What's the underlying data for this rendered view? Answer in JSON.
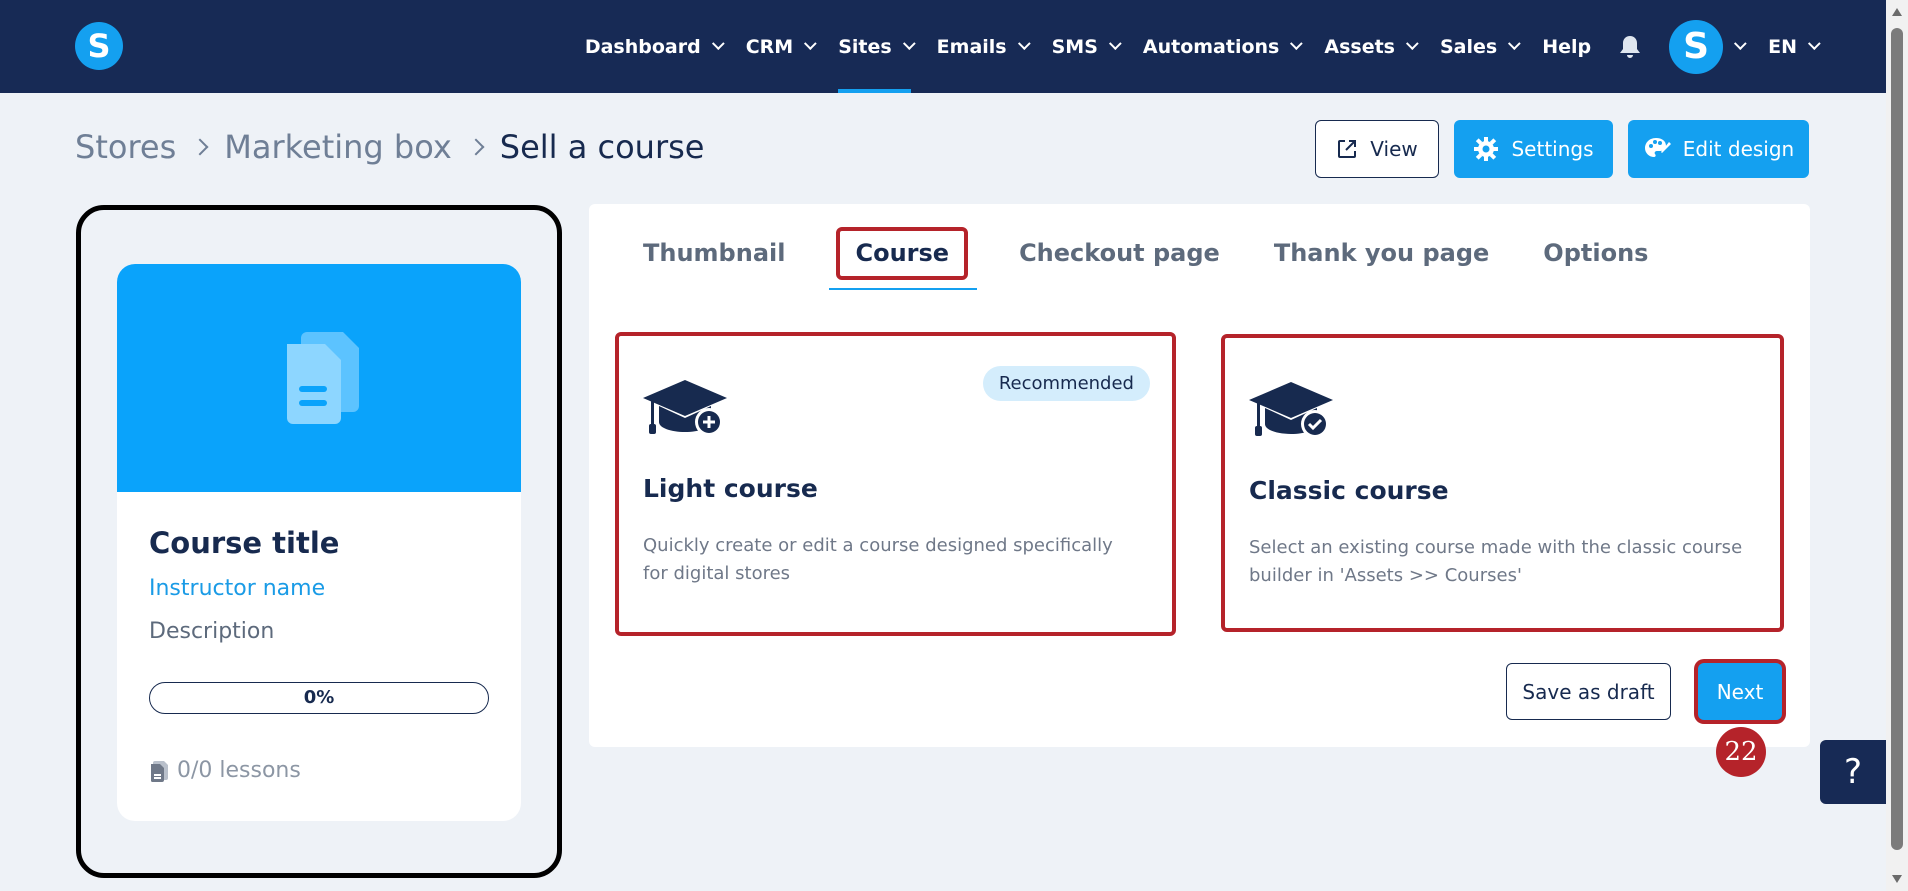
{
  "nav": {
    "items": [
      {
        "label": "Dashboard",
        "dropdown": true,
        "active": false
      },
      {
        "label": "CRM",
        "dropdown": true,
        "active": false
      },
      {
        "label": "Sites",
        "dropdown": true,
        "active": true
      },
      {
        "label": "Emails",
        "dropdown": true,
        "active": false
      },
      {
        "label": "SMS",
        "dropdown": true,
        "active": false
      },
      {
        "label": "Automations",
        "dropdown": true,
        "active": false
      },
      {
        "label": "Assets",
        "dropdown": true,
        "active": false
      },
      {
        "label": "Sales",
        "dropdown": true,
        "active": false
      },
      {
        "label": "Help",
        "dropdown": false,
        "active": false
      }
    ],
    "logo_letter": "S",
    "avatar_letter": "S",
    "language": "EN",
    "bell_icon": "bell-icon"
  },
  "breadcrumb": {
    "items": [
      "Stores",
      "Marketing box",
      "Sell a course"
    ]
  },
  "toolbar": {
    "view_label": "View",
    "settings_label": "Settings",
    "edit_design_label": "Edit design"
  },
  "preview": {
    "course_title": "Course title",
    "instructor": "Instructor name",
    "description": "Description",
    "progress": "0%",
    "progress_value": 0,
    "lessons": "0/0 lessons"
  },
  "tabs": [
    "Thumbnail",
    "Course",
    "Checkout page",
    "Thank you page",
    "Options"
  ],
  "active_tab": "Course",
  "options": {
    "light": {
      "title": "Light course",
      "badge": "Recommended",
      "description": "Quickly create or edit a course designed specifically for digital stores"
    },
    "classic": {
      "title": "Classic course",
      "description": "Select an existing course made with the classic course builder in 'Assets >> Courses'"
    }
  },
  "actions": {
    "save_draft_label": "Save as draft",
    "next_label": "Next"
  },
  "step_badge": "22",
  "help_label": "?",
  "colors": {
    "nav_bg": "#172a55",
    "accent": "#14a0f0",
    "highlight": "#b5232a",
    "page_bg": "#eef2f7"
  }
}
